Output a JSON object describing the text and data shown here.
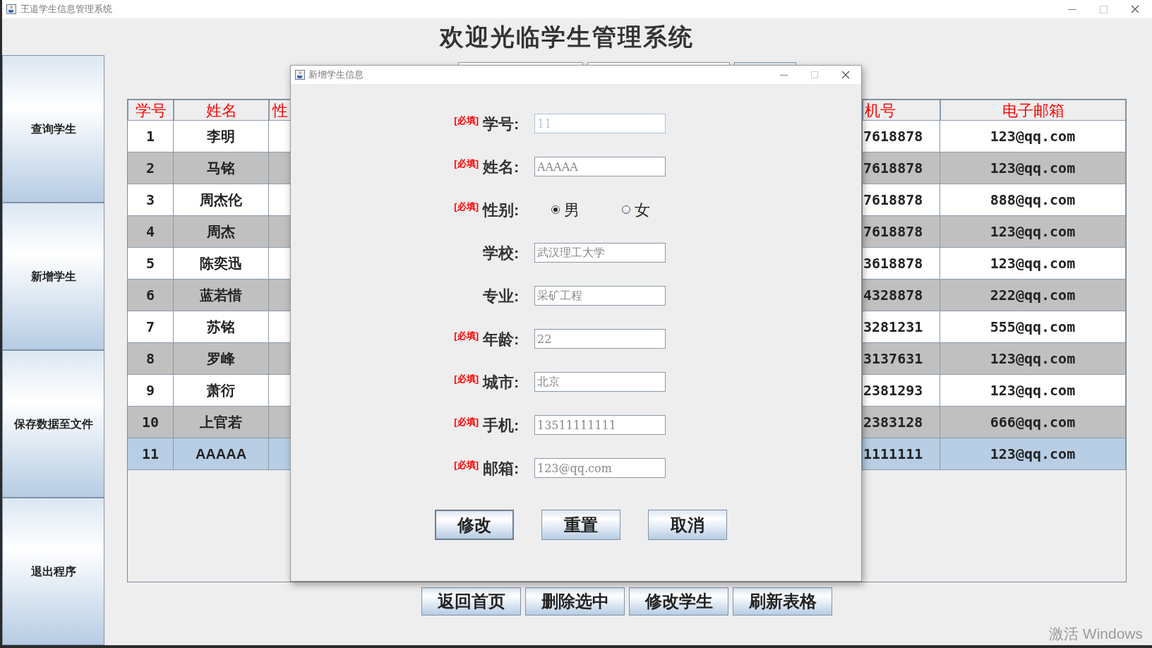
{
  "window": {
    "title": "王道学生信息管理系统"
  },
  "heading": "欢迎光临学生管理系统",
  "sidebar": {
    "items": [
      {
        "label": "查询学生"
      },
      {
        "label": "新增学生"
      },
      {
        "label": "保存数据至文件"
      },
      {
        "label": "退出程序"
      }
    ]
  },
  "table": {
    "columns": [
      "学号",
      "姓名",
      "性",
      "机号",
      "电子邮箱"
    ],
    "rows": [
      {
        "id": "1",
        "name": "李明",
        "phone": "7618878",
        "email": "123@qq.com",
        "selected": false
      },
      {
        "id": "2",
        "name": "马铭",
        "phone": "7618878",
        "email": "123@qq.com",
        "selected": false
      },
      {
        "id": "3",
        "name": "周杰伦",
        "phone": "7618878",
        "email": "888@qq.com",
        "selected": false
      },
      {
        "id": "4",
        "name": "周杰",
        "phone": "7618878",
        "email": "123@qq.com",
        "selected": false
      },
      {
        "id": "5",
        "name": "陈奕迅",
        "phone": "3618878",
        "email": "123@qq.com",
        "selected": false
      },
      {
        "id": "6",
        "name": "蓝若惜",
        "phone": "4328878",
        "email": "222@qq.com",
        "selected": false
      },
      {
        "id": "7",
        "name": "苏铭",
        "phone": "3281231",
        "email": "555@qq.com",
        "selected": false
      },
      {
        "id": "8",
        "name": "罗峰",
        "phone": "3137631",
        "email": "123@qq.com",
        "selected": false
      },
      {
        "id": "9",
        "name": "萧衍",
        "phone": "2381293",
        "email": "123@qq.com",
        "selected": false
      },
      {
        "id": "10",
        "name": "上官若",
        "phone": "2383128",
        "email": "666@qq.com",
        "selected": false
      },
      {
        "id": "11",
        "name": "AAAAA",
        "phone": "1111111",
        "email": "123@qq.com",
        "selected": true
      }
    ]
  },
  "actions": [
    "返回首页",
    "删除选中",
    "修改学生",
    "刷新表格"
  ],
  "dialog": {
    "title": "新增学生信息",
    "fields": [
      {
        "kind": "text",
        "required_tag": "[必填]",
        "label": "学号:",
        "value": "11",
        "disabled": true
      },
      {
        "kind": "text",
        "required_tag": "[必填]",
        "label": "姓名:",
        "value": "AAAAA",
        "disabled": false
      },
      {
        "kind": "radio",
        "required_tag": "[必填]",
        "label": "性别:",
        "options": [
          {
            "label": "男",
            "selected": true
          },
          {
            "label": "女",
            "selected": false
          }
        ]
      },
      {
        "kind": "text",
        "label": "学校:",
        "value": "武汉理工大学",
        "disabled": false
      },
      {
        "kind": "text",
        "label": "专业:",
        "value": "采矿工程",
        "disabled": false
      },
      {
        "kind": "text",
        "required_tag": "[必填]",
        "label": "年龄:",
        "value": "22",
        "disabled": false
      },
      {
        "kind": "text",
        "required_tag": "[必填]",
        "label": "城市:",
        "value": "北京",
        "disabled": false
      },
      {
        "kind": "text",
        "required_tag": "[必填]",
        "label": "手机:",
        "value": "13511111111",
        "disabled": false
      },
      {
        "kind": "text",
        "required_tag": "[必填]",
        "label": "邮箱:",
        "value": "123@qq.com",
        "disabled": false
      }
    ],
    "buttons": [
      "修改",
      "重置",
      "取消"
    ]
  },
  "os_notice": "激活 Windows"
}
